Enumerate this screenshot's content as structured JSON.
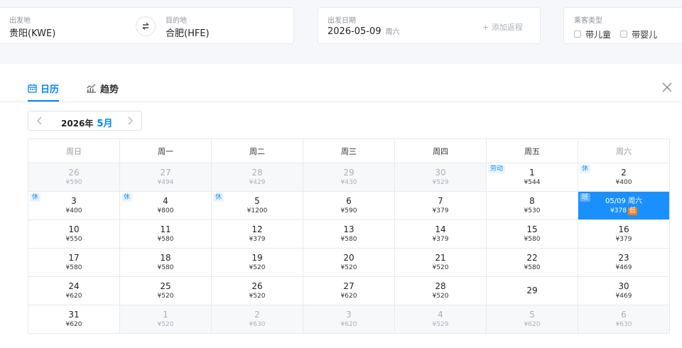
{
  "search": {
    "from_label": "出发地",
    "from_value": "贵阳(KWE)",
    "to_label": "目的地",
    "to_value": "合肥(HFE)",
    "date_label": "出发日期",
    "date_value": "2026-05-09",
    "date_dow": "周六",
    "add_return": "+ 添加返程",
    "pax_label": "乘客类型",
    "child_label": "带儿童",
    "infant_label": "带婴儿"
  },
  "tabs": {
    "calendar": "日历",
    "trend": "趋势"
  },
  "month_nav": {
    "year": "2026年",
    "month": "5月"
  },
  "weekdays": [
    "周日",
    "周一",
    "周二",
    "周三",
    "周四",
    "周五",
    "周六"
  ],
  "weeks": [
    [
      {
        "d": "26",
        "p": "¥590",
        "other": true
      },
      {
        "d": "27",
        "p": "¥494",
        "other": true
      },
      {
        "d": "28",
        "p": "¥429",
        "other": true
      },
      {
        "d": "29",
        "p": "¥430",
        "other": true
      },
      {
        "d": "30",
        "p": "¥529",
        "other": true
      },
      {
        "d": "1",
        "p": "¥544",
        "tag": "劳动"
      },
      {
        "d": "2",
        "p": "¥400",
        "tag": "休"
      }
    ],
    [
      {
        "d": "3",
        "p": "¥400",
        "tag": "休"
      },
      {
        "d": "4",
        "p": "¥800",
        "tag": "休"
      },
      {
        "d": "5",
        "p": "¥1200",
        "tag": "休"
      },
      {
        "d": "6",
        "p": "¥590"
      },
      {
        "d": "7",
        "p": "¥379"
      },
      {
        "d": "8",
        "p": "¥530"
      },
      {
        "d": "05/09 周六",
        "p": "¥378",
        "tag": "班",
        "selected": true,
        "low": "低"
      }
    ],
    [
      {
        "d": "10",
        "p": "¥550"
      },
      {
        "d": "11",
        "p": "¥580"
      },
      {
        "d": "12",
        "p": "¥379"
      },
      {
        "d": "13",
        "p": "¥580"
      },
      {
        "d": "14",
        "p": "¥379"
      },
      {
        "d": "15",
        "p": "¥580"
      },
      {
        "d": "16",
        "p": "¥379"
      }
    ],
    [
      {
        "d": "17",
        "p": "¥580"
      },
      {
        "d": "18",
        "p": "¥580"
      },
      {
        "d": "19",
        "p": "¥520"
      },
      {
        "d": "20",
        "p": "¥520"
      },
      {
        "d": "21",
        "p": "¥520"
      },
      {
        "d": "22",
        "p": "¥580"
      },
      {
        "d": "23",
        "p": "¥469"
      }
    ],
    [
      {
        "d": "24",
        "p": "¥620"
      },
      {
        "d": "25",
        "p": "¥520"
      },
      {
        "d": "26",
        "p": "¥520"
      },
      {
        "d": "27",
        "p": "¥620"
      },
      {
        "d": "28",
        "p": "¥520"
      },
      {
        "d": "29",
        "p": ""
      },
      {
        "d": "30",
        "p": "¥469"
      }
    ],
    [
      {
        "d": "31",
        "p": "¥620"
      },
      {
        "d": "1",
        "p": "¥520",
        "other": true
      },
      {
        "d": "2",
        "p": "¥630",
        "other": true
      },
      {
        "d": "3",
        "p": "¥620",
        "other": true
      },
      {
        "d": "4",
        "p": "¥529",
        "other": true
      },
      {
        "d": "5",
        "p": "¥620",
        "other": true
      },
      {
        "d": "6",
        "p": "¥630",
        "other": true
      }
    ]
  ],
  "colors": {
    "accent": "#0086f6",
    "selected": "#1a90ff",
    "low_badge": "#ff7d13",
    "holiday_tag": "#1a8ef5"
  },
  "icons": {
    "swap": "swap-arrows-icon",
    "calendar": "calendar-icon",
    "trend": "trend-chart-icon",
    "close": "close-icon",
    "prev": "chevron-left-icon",
    "next": "chevron-right-icon"
  }
}
